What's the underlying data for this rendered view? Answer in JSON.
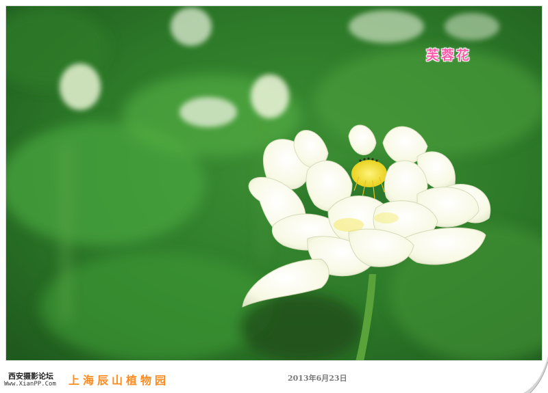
{
  "caption": {
    "title": "芙蓉花"
  },
  "footer": {
    "forum_name": "西安摄影论坛",
    "forum_url": "Www.XianPP.Com",
    "location": "上海辰山植物园",
    "date": "2013年6月23日"
  },
  "colors": {
    "caption_title": "#ff5aa8",
    "location": "#ff8a1c",
    "date": "#7a7a7a",
    "foliage": "#2f7a2c",
    "petal": "#fbfbe6",
    "stamen": "#f2e030"
  },
  "photo": {
    "subject": "lotus-flower-photo"
  }
}
